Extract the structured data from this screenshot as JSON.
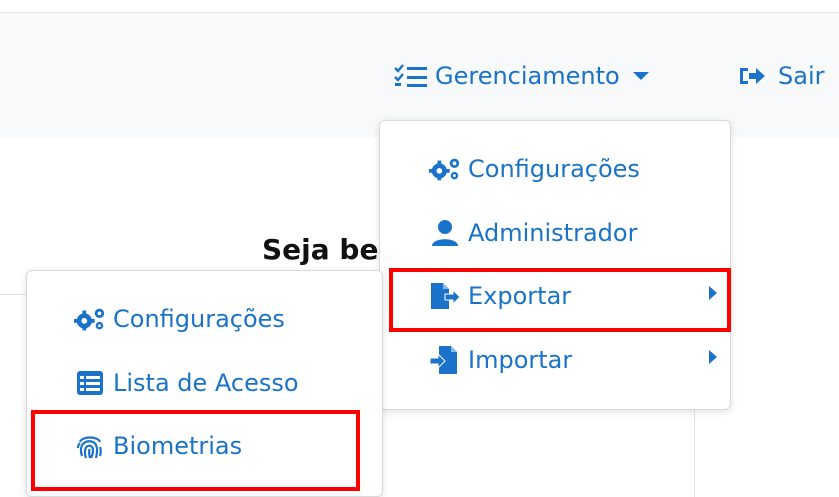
{
  "navbar": {
    "gerenciamento_label": "Gerenciamento",
    "sair_label": "Sair"
  },
  "page": {
    "welcome_text": "Seja be"
  },
  "main_menu": {
    "items": [
      {
        "label": "Configurações",
        "icon": "gears-icon"
      },
      {
        "label": "Administrador",
        "icon": "user-icon"
      },
      {
        "label": "Exportar",
        "icon": "file-export-icon",
        "has_submenu": true,
        "highlighted": true
      },
      {
        "label": "Importar",
        "icon": "file-import-icon",
        "has_submenu": true
      }
    ]
  },
  "submenu": {
    "items": [
      {
        "label": "Configurações",
        "icon": "gears-icon"
      },
      {
        "label": "Lista de Acesso",
        "icon": "list-table-icon"
      },
      {
        "label": "Biometrias",
        "icon": "fingerprint-icon",
        "highlighted": true
      }
    ]
  },
  "colors": {
    "link": "#1a73c8",
    "highlight": "#ff0000",
    "navbar_bg": "#f8f9fa"
  }
}
